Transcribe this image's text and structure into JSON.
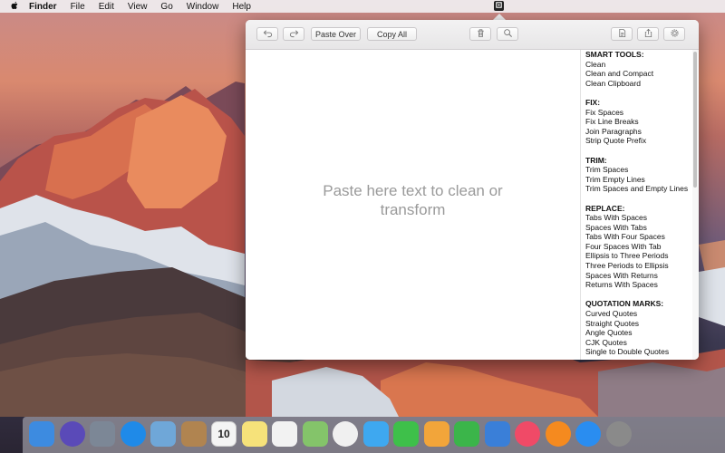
{
  "menubar": {
    "apple_icon": "apple-icon",
    "items": [
      "Finder",
      "File",
      "Edit",
      "View",
      "Go",
      "Window",
      "Help"
    ],
    "status_icon": "app-status-icon"
  },
  "toolbar": {
    "undo_icon": "undo-icon",
    "redo_icon": "redo-icon",
    "paste_over_label": "Paste Over",
    "copy_all_label": "Copy All",
    "trash_icon": "trash-icon",
    "search_icon": "search-icon",
    "document_icon": "document-icon",
    "share_icon": "share-icon",
    "settings_icon": "gear-icon"
  },
  "editor": {
    "placeholder": "Paste here text to clean or transform"
  },
  "tools": [
    {
      "heading": "SMART TOOLS:",
      "items": [
        "Clean",
        "Clean and Compact",
        "Clean Clipboard"
      ]
    },
    {
      "heading": "FIX:",
      "items": [
        "Fix Spaces",
        "Fix Line Breaks",
        "Join Paragraphs",
        "Strip Quote Prefix"
      ]
    },
    {
      "heading": "TRIM:",
      "items": [
        "Trim Spaces",
        "Trim Empty Lines",
        "Trim Spaces and Empty Lines"
      ]
    },
    {
      "heading": "REPLACE:",
      "items": [
        "Tabs With Spaces",
        "Spaces With Tabs",
        "Tabs With Four Spaces",
        "Four Spaces With Tab",
        "Ellipsis to Three Periods",
        "Three Periods to Ellipsis",
        "Spaces With Returns",
        "Returns With Spaces"
      ]
    },
    {
      "heading": "QUOTATION MARKS:",
      "items": [
        "Curved Quotes",
        "Straight Quotes",
        "Angle Quotes",
        "CJK Quotes",
        "Single to Double Quotes"
      ]
    }
  ],
  "dock": {
    "apps": [
      {
        "name": "finder-icon",
        "color": "#3d8be0"
      },
      {
        "name": "siri-icon",
        "color": "#5a4ab8"
      },
      {
        "name": "launchpad-icon",
        "color": "#7c8796"
      },
      {
        "name": "safari-icon",
        "color": "#1f8ae8"
      },
      {
        "name": "mail-icon",
        "color": "#6fa7d8"
      },
      {
        "name": "contacts-icon",
        "color": "#b08450"
      },
      {
        "name": "calendar-icon",
        "color": "#f4f4f4",
        "text": "10"
      },
      {
        "name": "notes-icon",
        "color": "#f6e27a"
      },
      {
        "name": "reminders-icon",
        "color": "#f2f2f2"
      },
      {
        "name": "maps-icon",
        "color": "#84c46a"
      },
      {
        "name": "photos-icon",
        "color": "#f0f0f0"
      },
      {
        "name": "messages-icon",
        "color": "#3ea8f0"
      },
      {
        "name": "facetime-icon",
        "color": "#3ec04a"
      },
      {
        "name": "pages-icon",
        "color": "#f2a53a"
      },
      {
        "name": "numbers-icon",
        "color": "#3bb54a"
      },
      {
        "name": "keynote-icon",
        "color": "#3a7fd8"
      },
      {
        "name": "music-icon",
        "color": "#f04a67"
      },
      {
        "name": "books-icon",
        "color": "#f58a1f"
      },
      {
        "name": "app-store-icon",
        "color": "#2a8df0"
      },
      {
        "name": "system-preferences-icon",
        "color": "#8a8a8a"
      }
    ]
  }
}
